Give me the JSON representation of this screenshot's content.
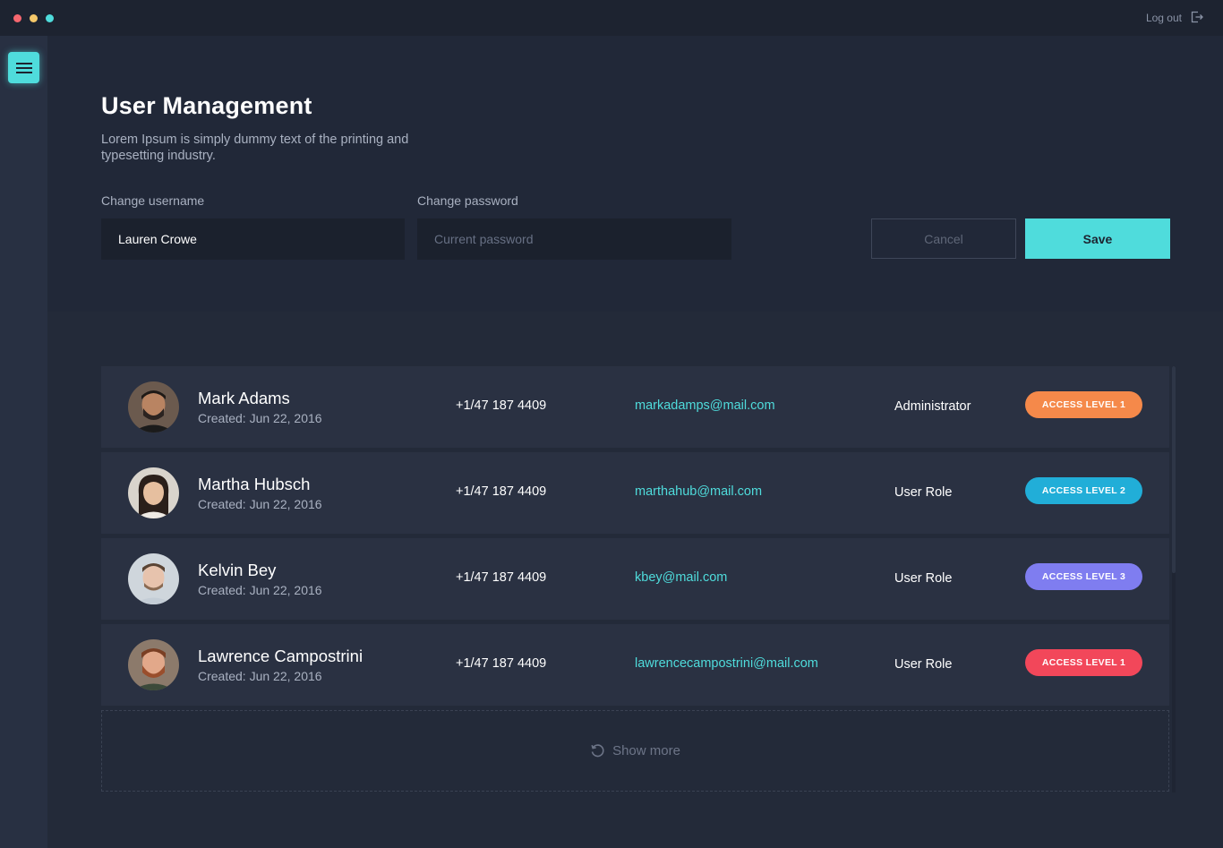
{
  "window": {
    "logout_label": "Log out"
  },
  "header": {
    "title": "User Management",
    "description": "Lorem Ipsum is simply dummy text of the printing and typesetting industry."
  },
  "form": {
    "username_label": "Change username",
    "username_value": "Lauren Crowe",
    "password_label": "Change password",
    "password_placeholder": "Current password",
    "cancel_label": "Cancel",
    "save_label": "Save"
  },
  "users": [
    {
      "name": "Mark Adams",
      "created_label": "Created:",
      "created_date": "Jun 22, 2016",
      "phone": "+1/47 187 4409",
      "email": "markadamps@mail.com",
      "role": "Administrator",
      "access": "ACCESS LEVEL 1",
      "access_color": "#f5894a"
    },
    {
      "name": "Martha Hubsch",
      "created_label": "Created:",
      "created_date": "Jun 22, 2016",
      "phone": "+1/47 187 4409",
      "email": "marthahub@mail.com",
      "role": "User Role",
      "access": "ACCESS LEVEL 2",
      "access_color": "#21aed8"
    },
    {
      "name": "Kelvin Bey",
      "created_label": "Created:",
      "created_date": "Jun 22, 2016",
      "phone": "+1/47 187 4409",
      "email": "kbey@mail.com",
      "role": "User Role",
      "access": "ACCESS LEVEL 3",
      "access_color": "#7f7df0"
    },
    {
      "name": "Lawrence Campostrini",
      "created_label": "Created:",
      "created_date": "Jun 22, 2016",
      "phone": "+1/47 187 4409",
      "email": "lawrencecampostrini@mail.com",
      "role": "User Role",
      "access": "ACCESS LEVEL 1",
      "access_color": "#f2475a"
    }
  ],
  "show_more_label": "Show more",
  "colors": {
    "accent": "#4fdcdc",
    "background": "#232a39",
    "panel": "#212838",
    "row": "#2a3142"
  }
}
